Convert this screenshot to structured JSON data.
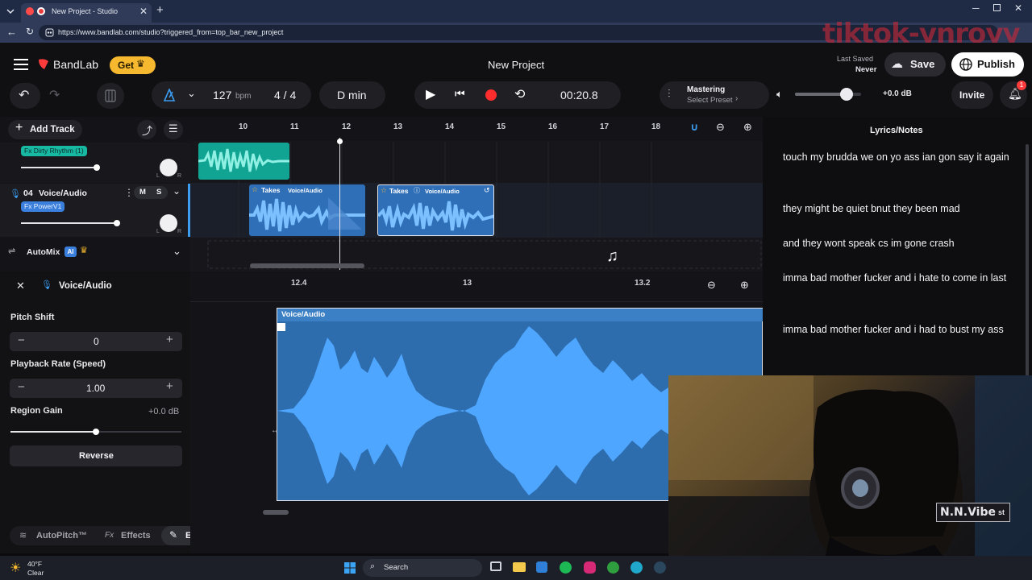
{
  "browser": {
    "tab_title": "New Project - Studio",
    "url": "https://www.bandlab.com/studio?triggered_from=top_bar_new_project"
  },
  "watermark": "tiktok-ynroyy",
  "header": {
    "logo": "BandLab",
    "get_label": "Get",
    "project_title": "New Project",
    "last_saved_label": "Last Saved",
    "last_saved_value": "Never",
    "save_label": "Save",
    "publish_label": "Publish"
  },
  "transport": {
    "bpm_value": "127",
    "bpm_unit": "bpm",
    "time_signature": "4 / 4",
    "key": "D min",
    "time": "00:20.8",
    "mastering_label": "Mastering",
    "mastering_preset": "Select Preset",
    "master_volume": "+0.0 dB",
    "master_volume_level": 0.78,
    "invite_label": "Invite",
    "notification_count": "1"
  },
  "tracks_panel": {
    "add_track_label": "Add Track",
    "track1_fx": "Fx Dirty Rhythm (1)",
    "track2_number": "04",
    "track2_name": "Voice/Audio",
    "track2_mute": "M",
    "track2_solo": "S",
    "track2_fx": "Fx PowerV1",
    "automix_label": "AutoMix",
    "ai_badge": "AI"
  },
  "ruler": {
    "ticks": [
      "10",
      "11",
      "12",
      "13",
      "14",
      "15",
      "16",
      "17",
      "18"
    ]
  },
  "clips": {
    "takes_label": "Takes",
    "clip_name": "Voice/Audio"
  },
  "editor": {
    "title": "Voice/Audio",
    "pitch_shift_label": "Pitch Shift",
    "pitch_shift_value": "0",
    "playback_rate_label": "Playback Rate (Speed)",
    "playback_rate_value": "1.00",
    "region_gain_label": "Region Gain",
    "region_gain_value": "+0.0 dB",
    "region_gain_level": 0.5,
    "reverse_label": "Reverse",
    "ruler_ticks": [
      "12.4",
      "13",
      "13.2"
    ],
    "region_name": "Voice/Audio",
    "bottom_tabs": [
      "AutoPitch™",
      "Effects",
      "Editor"
    ]
  },
  "lyrics": {
    "title": "Lyrics/Notes",
    "lines": [
      "touch my brudda we on yo ass ian gon say it again",
      "they might be quiet bnut they been mad",
      "and they wont speak cs im gone crash",
      "imma bad mother fucker and i hate to come in last",
      "imma bad mother fucker and i had to bust my ass"
    ]
  },
  "webcam": {
    "sign_text": "N.N.Vibe",
    "sign_suffix": "st"
  },
  "taskbar": {
    "weather_temp": "40°F",
    "weather_desc": "Clear",
    "search_placeholder": "Search"
  },
  "colors": {
    "accent_blue": "#3b9cf0",
    "teal_clip": "#1fb5a4",
    "get_gold": "#f5b82e",
    "record_red": "#ff2d2d"
  }
}
